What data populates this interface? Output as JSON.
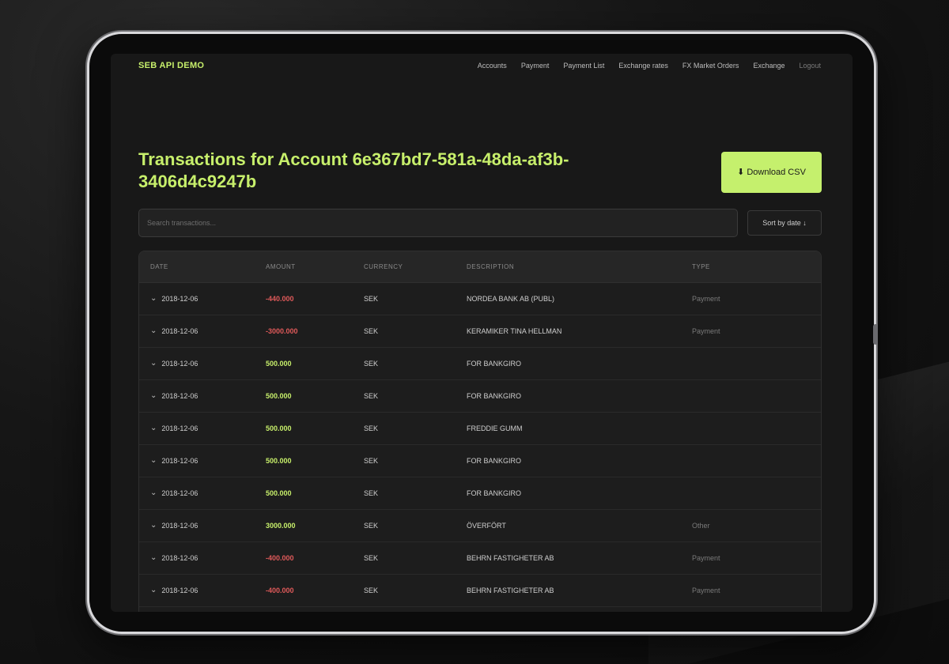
{
  "nav": {
    "brand": "SEB API DEMO",
    "links": [
      "Accounts",
      "Payment",
      "Payment List",
      "Exchange rates",
      "FX Market Orders",
      "Exchange",
      "Logout"
    ]
  },
  "page": {
    "title": "Transactions for Account 6e367bd7-581a-48da-af3b-3406d4c9247b",
    "download_label": "⬇ Download CSV",
    "search_placeholder": "Search transactions...",
    "sort_label": "Sort by date ↓"
  },
  "table": {
    "headers": [
      "DATE",
      "AMOUNT",
      "CURRENCY",
      "DESCRIPTION",
      "TYPE"
    ],
    "rows": [
      {
        "date": "2018-12-06",
        "amount": "-440.000",
        "sign": "neg",
        "currency": "SEK",
        "description": "NORDEA BANK AB (PUBL)",
        "type": "Payment"
      },
      {
        "date": "2018-12-06",
        "amount": "-3000.000",
        "sign": "neg",
        "currency": "SEK",
        "description": "KERAMIKER TINA HELLMAN",
        "type": "Payment"
      },
      {
        "date": "2018-12-06",
        "amount": "500.000",
        "sign": "pos",
        "currency": "SEK",
        "description": "FOR BANKGIRO",
        "type": ""
      },
      {
        "date": "2018-12-06",
        "amount": "500.000",
        "sign": "pos",
        "currency": "SEK",
        "description": "FOR BANKGIRO",
        "type": ""
      },
      {
        "date": "2018-12-06",
        "amount": "500.000",
        "sign": "pos",
        "currency": "SEK",
        "description": "FREDDIE GUMM",
        "type": ""
      },
      {
        "date": "2018-12-06",
        "amount": "500.000",
        "sign": "pos",
        "currency": "SEK",
        "description": "FOR BANKGIRO",
        "type": ""
      },
      {
        "date": "2018-12-06",
        "amount": "500.000",
        "sign": "pos",
        "currency": "SEK",
        "description": "FOR BANKGIRO",
        "type": ""
      },
      {
        "date": "2018-12-06",
        "amount": "3000.000",
        "sign": "pos",
        "currency": "SEK",
        "description": "ÖVERFÖRT",
        "type": "Other"
      },
      {
        "date": "2018-12-06",
        "amount": "-400.000",
        "sign": "neg",
        "currency": "SEK",
        "description": "BEHRN FASTIGHETER AB",
        "type": "Payment"
      },
      {
        "date": "2018-12-06",
        "amount": "-400.000",
        "sign": "neg",
        "currency": "SEK",
        "description": "BEHRN FASTIGHETER AB",
        "type": "Payment"
      }
    ]
  },
  "colors": {
    "accent": "#c7ef6b",
    "negative": "#e05a5a",
    "background": "#181818"
  },
  "icons": {
    "row_toggle": "chevron-down-icon",
    "download": "download-arrow-icon",
    "sort": "arrow-down-icon"
  }
}
